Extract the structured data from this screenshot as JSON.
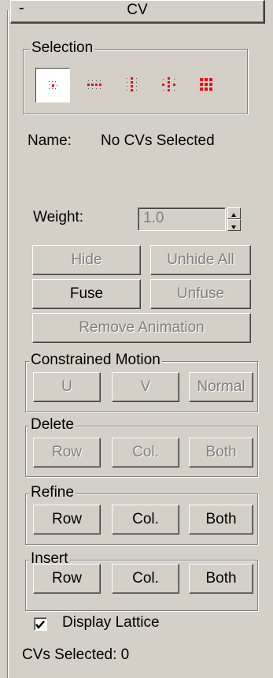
{
  "rollout": {
    "title": "CV",
    "collapse_symbol": "-"
  },
  "selection": {
    "legend": "Selection",
    "levels": [
      "single-cv",
      "row-cv",
      "column-cv",
      "row-column-cv",
      "all-cv"
    ],
    "active_level": "single-cv",
    "icon_color": "#ff0000"
  },
  "name": {
    "label": "Name:",
    "value": "No CVs Selected"
  },
  "weight": {
    "label": "Weight:",
    "value": "1.0"
  },
  "buttons": {
    "hide": "Hide",
    "unhide_all": "Unhide All",
    "fuse": "Fuse",
    "unfuse": "Unfuse",
    "remove_animation": "Remove Animation"
  },
  "constrained_motion": {
    "legend": "Constrained Motion",
    "u": "U",
    "v": "V",
    "normal": "Normal"
  },
  "delete": {
    "legend": "Delete",
    "row": "Row",
    "col": "Col.",
    "both": "Both"
  },
  "refine": {
    "legend": "Refine",
    "row": "Row",
    "col": "Col.",
    "both": "Both"
  },
  "insert": {
    "legend": "Insert",
    "row": "Row",
    "col": "Col.",
    "both": "Both"
  },
  "display_lattice": {
    "label": "Display Lattice",
    "checked": true
  },
  "status": {
    "text": "CVs Selected: 0"
  }
}
